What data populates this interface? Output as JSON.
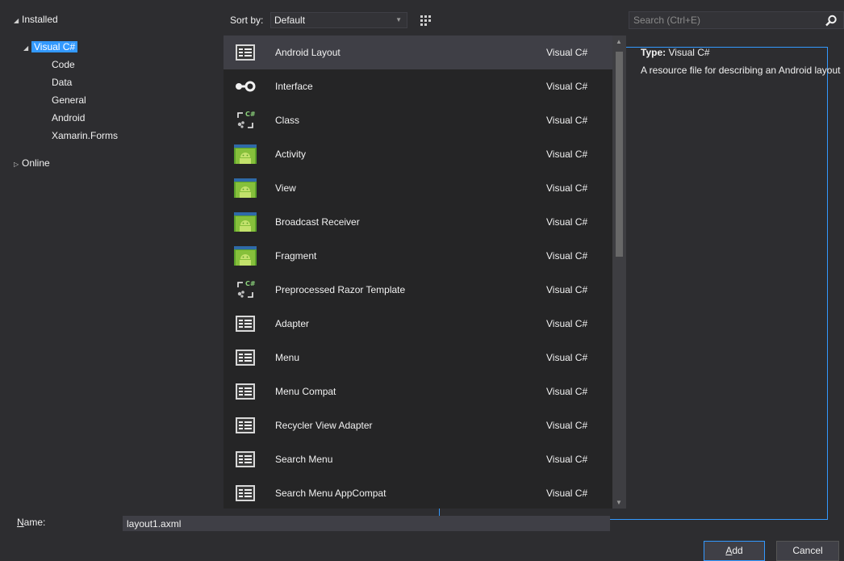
{
  "tree": {
    "installed_label": "Installed",
    "visual_csharp_label": "Visual C#",
    "children": [
      "Code",
      "Data",
      "General",
      "Android",
      "Xamarin.Forms"
    ],
    "online_label": "Online"
  },
  "sort": {
    "label": "Sort by:",
    "value": "Default"
  },
  "templates": [
    {
      "name": "Android Layout",
      "lang": "Visual C#",
      "icon": "layout-icon"
    },
    {
      "name": "Interface",
      "lang": "Visual C#",
      "icon": "interface-icon"
    },
    {
      "name": "Class",
      "lang": "Visual C#",
      "icon": "csharp-class-icon"
    },
    {
      "name": "Activity",
      "lang": "Visual C#",
      "icon": "android-icon"
    },
    {
      "name": "View",
      "lang": "Visual C#",
      "icon": "android-icon"
    },
    {
      "name": "Broadcast Receiver",
      "lang": "Visual C#",
      "icon": "android-icon"
    },
    {
      "name": "Fragment",
      "lang": "Visual C#",
      "icon": "android-icon"
    },
    {
      "name": "Preprocessed Razor Template",
      "lang": "Visual C#",
      "icon": "csharp-class-icon"
    },
    {
      "name": "Adapter",
      "lang": "Visual C#",
      "icon": "layout-icon"
    },
    {
      "name": "Menu",
      "lang": "Visual C#",
      "icon": "layout-icon"
    },
    {
      "name": "Menu Compat",
      "lang": "Visual C#",
      "icon": "layout-icon"
    },
    {
      "name": "Recycler View Adapter",
      "lang": "Visual C#",
      "icon": "layout-icon"
    },
    {
      "name": "Search Menu",
      "lang": "Visual C#",
      "icon": "layout-icon"
    },
    {
      "name": "Search Menu AppCompat",
      "lang": "Visual C#",
      "icon": "layout-icon"
    }
  ],
  "search": {
    "placeholder": "Search (Ctrl+E)"
  },
  "details": {
    "type_key": "Type:",
    "type_value": "Visual C#",
    "description": "A resource file for describing an Android layout"
  },
  "name": {
    "label_mnemonic": "N",
    "label_rest": "ame:",
    "value": "layout1.axml"
  },
  "buttons": {
    "add_mnemonic": "A",
    "add_rest": "dd",
    "cancel": "Cancel"
  },
  "colors": {
    "background": "#2d2d30",
    "list_background": "#252526",
    "selection": "#3399ff",
    "selected_row": "#3f3f46"
  }
}
